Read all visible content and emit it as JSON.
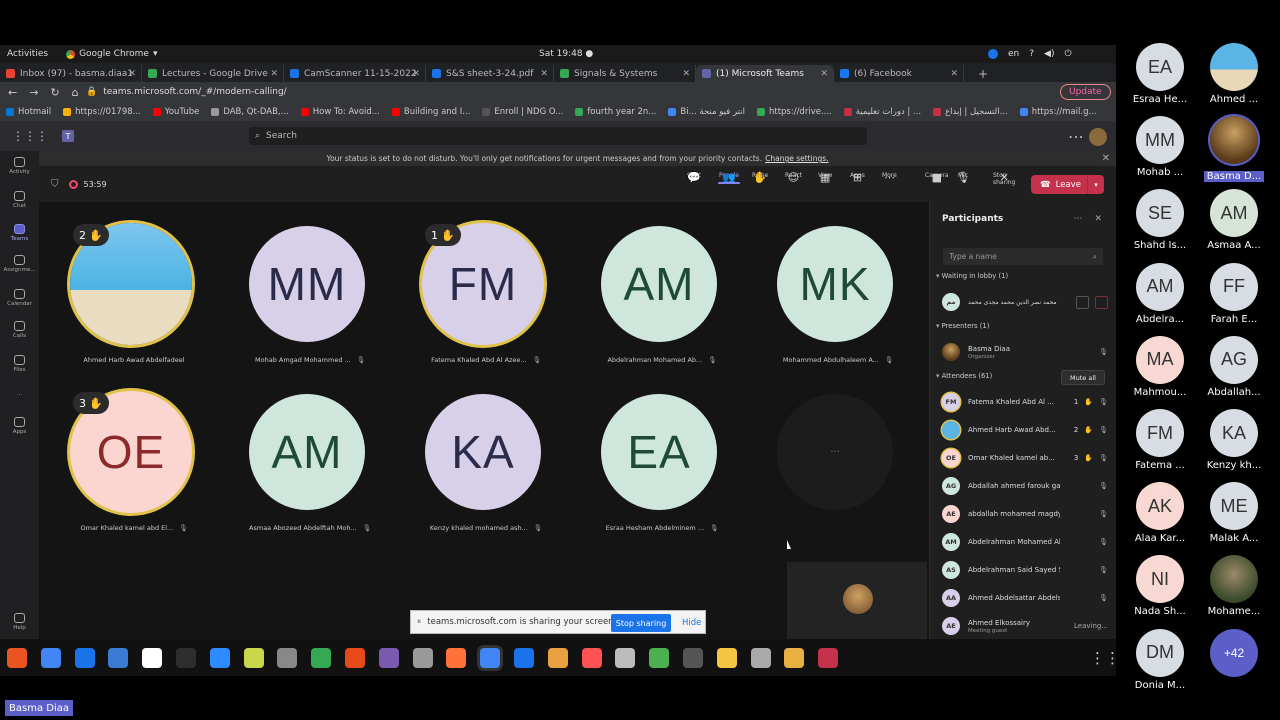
{
  "os": {
    "activities": "Activities",
    "app": "Google Chrome",
    "clock": "Sat 19:48 ●",
    "lang": "en"
  },
  "browser": {
    "tabs": [
      {
        "label": "Inbox (97) - basma.diaa1",
        "color": "#ea4335"
      },
      {
        "label": "Lectures - Google Drive",
        "color": "#34a853"
      },
      {
        "label": "CamScanner 11-15-2022",
        "color": "#1a73e8"
      },
      {
        "label": "S&S sheet-3-24.pdf",
        "color": "#1a73e8"
      },
      {
        "label": "Signals & Systems",
        "color": "#34a853"
      },
      {
        "label": "(1) Microsoft Teams",
        "color": "#6264a7"
      },
      {
        "label": "(6) Facebook",
        "color": "#1877f2"
      }
    ],
    "url": "teams.microsoft.com/_#/modern-calling/",
    "update": "Update",
    "bookmarks": [
      {
        "label": "Hotmail",
        "color": "#0078d4"
      },
      {
        "label": "https://01798...",
        "color": "#f4b400"
      },
      {
        "label": "YouTube",
        "color": "#ff0000"
      },
      {
        "label": "DAB, Qt-DAB,...",
        "color": "#999999"
      },
      {
        "label": "How To: Avoid...",
        "color": "#ff0000"
      },
      {
        "label": "Building and I...",
        "color": "#ff0000"
      },
      {
        "label": "Enroll | NDG O...",
        "color": "#555555"
      },
      {
        "label": "fourth year 2n...",
        "color": "#34a853"
      },
      {
        "label": "Bi... انتر فيو منحة",
        "color": "#4285f4"
      },
      {
        "label": "https://drive....",
        "color": "#34a853"
      },
      {
        "label": "دورات تعليمية | ...",
        "color": "#c4314b"
      },
      {
        "label": "التسجيل | إبداع...",
        "color": "#c4314b"
      },
      {
        "label": "https://mail.g...",
        "color": "#4285f4"
      }
    ]
  },
  "teams": {
    "search": "Search",
    "rail": [
      "Activity",
      "Chat",
      "Teams",
      "Assignme...",
      "Calendar",
      "Calls",
      "Files",
      "...",
      "Apps",
      "Help"
    ],
    "dnd": {
      "text": "Your status is set to do not disturb. You'll only get notifications for urgent messages and from your priority contacts.",
      "link": "Change settings."
    },
    "timer": "53:59",
    "tools": [
      {
        "label": "Chat",
        "icon": "💬"
      },
      {
        "label": "People",
        "icon": "👥"
      },
      {
        "label": "Raise",
        "icon": "✋"
      },
      {
        "label": "React",
        "icon": "☺"
      },
      {
        "label": "View",
        "icon": "▦"
      },
      {
        "label": "Apps",
        "icon": "⊞"
      },
      {
        "label": "More",
        "icon": "⋯"
      },
      {
        "label": "Camera",
        "icon": "■"
      },
      {
        "label": "Mic",
        "icon": "🎙"
      },
      {
        "label": "Stop sharing",
        "icon": "✕"
      }
    ],
    "leave": "Leave"
  },
  "stage": {
    "tiles": [
      {
        "initials": "",
        "name": "Ahmed Harb Awad Abdelfadeel",
        "hand": "2",
        "color": "photo",
        "mic": false
      },
      {
        "initials": "MM",
        "name": "Mohab Amgad Mohammed ...",
        "hand": "",
        "color": "#d8cfe8",
        "mic": true
      },
      {
        "initials": "FM",
        "name": "Fatema Khaled Abd Al Azee...",
        "hand": "1",
        "color": "#d8cfe8",
        "mic": true
      },
      {
        "initials": "AM",
        "name": "Abdelrahman Mohamed Ab...",
        "hand": "",
        "color": "#cfe6dc",
        "mic": true
      },
      {
        "initials": "MK",
        "name": "Mohammed Abdulhaleem A...",
        "hand": "",
        "color": "#cfe6dc",
        "mic": true
      },
      {
        "initials": "OE",
        "name": "Omar Khaled kamel abd El...",
        "hand": "3",
        "color": "#fbd5d0",
        "mic": true
      },
      {
        "initials": "AM",
        "name": "Asmaa Abozeed Abdelftah Moh...",
        "hand": "",
        "color": "#cfe6dc",
        "mic": true
      },
      {
        "initials": "KA",
        "name": "Kenzy khaled mohamed ash...",
        "hand": "",
        "color": "#d8cfe8",
        "mic": true
      },
      {
        "initials": "EA",
        "name": "Esraa Hesham Abdelminem ...",
        "hand": "",
        "color": "#cfe6dc",
        "mic": true
      },
      {
        "initials": "",
        "name": "",
        "hand": "",
        "color": "empty",
        "mic": false
      }
    ],
    "share": {
      "text": "teams.microsoft.com is sharing your screen.",
      "stop": "Stop sharing",
      "hide": "Hide"
    }
  },
  "participants": {
    "title": "Participants",
    "find": "Type a name",
    "lobby": "Waiting in lobby (1)",
    "lobby_name": "محمد نصر الدين محمد مجدى محمد",
    "presenters": "Presenters (1)",
    "presenter": {
      "name": "Basma Diaa",
      "role": "Organizer"
    },
    "attendees": "Attendees (61)",
    "muteall": "Mute all",
    "rows": [
      {
        "i": "FM",
        "name": "Fatema Khaled Abd Al ...",
        "cnt": "1",
        "color": "#d8cfe8"
      },
      {
        "i": "",
        "name": "Ahmed Harb Awad Abd...",
        "cnt": "2",
        "color": "#5ab4e6"
      },
      {
        "i": "OE",
        "name": "Omar Khaled kamel ab...",
        "cnt": "3",
        "color": "#fbd5d0"
      },
      {
        "i": "AG",
        "name": "Abdallah ahmed farouk gad",
        "cnt": "",
        "color": "#cfe6dc"
      },
      {
        "i": "AE",
        "name": "abdallah mohamed magdy kam...",
        "cnt": "",
        "color": "#fbd5d0"
      },
      {
        "i": "AM",
        "name": "Abdelrahman Mohamed Abdel...",
        "cnt": "",
        "color": "#cfe6dc"
      },
      {
        "i": "AS",
        "name": "Abdelrahman Said Sayed Salem",
        "cnt": "",
        "color": "#cfe6dc"
      },
      {
        "i": "AA",
        "name": "Ahmed Abdelsattar Abdelsatta...",
        "cnt": "",
        "color": "#d8cfe8"
      },
      {
        "i": "AE",
        "name": "Ahmed Elkossairy",
        "sub": "Meeting guest",
        "cnt": "",
        "color": "#d8cfe8",
        "status": "Leaving..."
      }
    ]
  },
  "gallery": [
    {
      "i": "EA",
      "name": "Esraa He...",
      "c": "#d8dde3"
    },
    {
      "i": "",
      "name": "Ahmed ...",
      "c": "photo1"
    },
    {
      "i": "MM",
      "name": "Mohab ...",
      "c": "#d8dde3"
    },
    {
      "i": "",
      "name": "Basma D...",
      "c": "photo2",
      "hl": true
    },
    {
      "i": "SE",
      "name": "Shahd Is...",
      "c": "#d8dde3"
    },
    {
      "i": "AM",
      "name": "Asmaa A...",
      "c": "#d6e4d8"
    },
    {
      "i": "AM",
      "name": "Abdelra...",
      "c": "#d8dde3"
    },
    {
      "i": "FF",
      "name": "Farah E...",
      "c": "#d8dde3"
    },
    {
      "i": "MA",
      "name": "Mahmou...",
      "c": "#f7d8d2"
    },
    {
      "i": "AG",
      "name": "Abdallah...",
      "c": "#d8dde3"
    },
    {
      "i": "FM",
      "name": "Fatema ...",
      "c": "#d8dde3"
    },
    {
      "i": "KA",
      "name": "Kenzy kh...",
      "c": "#d8dde3"
    },
    {
      "i": "AK",
      "name": "Alaa Kar...",
      "c": "#f7d8d2"
    },
    {
      "i": "ME",
      "name": "Malak A...",
      "c": "#d8dde3"
    },
    {
      "i": "NI",
      "name": "Nada Sh...",
      "c": "#f7d8d2"
    },
    {
      "i": "",
      "name": "Mohame...",
      "c": "photo3"
    },
    {
      "i": "DM",
      "name": "Donia M...",
      "c": "#d8dde3"
    },
    {
      "i": "+42",
      "name": "",
      "c": "more"
    }
  ],
  "nametag": "Basma Diaa"
}
